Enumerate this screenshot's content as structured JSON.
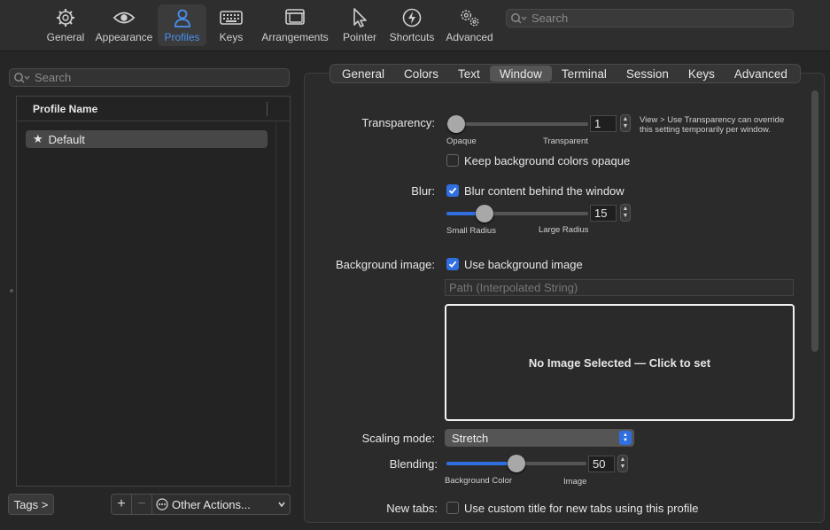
{
  "toolbar": {
    "items": [
      {
        "label": "General",
        "icon": "gear-icon"
      },
      {
        "label": "Appearance",
        "icon": "eye-icon"
      },
      {
        "label": "Profiles",
        "icon": "person-icon",
        "active": true
      },
      {
        "label": "Keys",
        "icon": "keyboard-icon"
      },
      {
        "label": "Arrangements",
        "icon": "windows-icon"
      },
      {
        "label": "Pointer",
        "icon": "pointer-icon"
      },
      {
        "label": "Shortcuts",
        "icon": "lightning-icon"
      },
      {
        "label": "Advanced",
        "icon": "gears-icon"
      }
    ],
    "search_placeholder": "Search"
  },
  "left": {
    "search_placeholder": "Search",
    "column_header": "Profile Name",
    "profiles": [
      {
        "name": "Default",
        "icon": "star-icon"
      }
    ],
    "tags_button": "Tags >",
    "add_button": "+",
    "remove_button": "−",
    "other_actions": "Other Actions..."
  },
  "tabs": [
    "General",
    "Colors",
    "Text",
    "Window",
    "Terminal",
    "Session",
    "Keys",
    "Advanced"
  ],
  "active_tab": "Window",
  "window": {
    "transparency": {
      "label": "Transparency:",
      "value": "1",
      "min_label": "Opaque",
      "max_label": "Transparent",
      "note": "View > Use Transparency can override this setting temporarily per window.",
      "level": 0.01
    },
    "keep_bg_opaque": {
      "label": "Keep background colors opaque",
      "checked": false
    },
    "blur": {
      "label": "Blur:",
      "checkbox_label": "Blur content behind the window",
      "checked": true,
      "value": "15",
      "min_label": "Small Radius",
      "max_label": "Large Radius"
    },
    "background_image": {
      "label": "Background image:",
      "checkbox_label": "Use background image",
      "checked": true,
      "path_placeholder": "Path (Interpolated String)",
      "well_text": "No Image Selected — Click to set"
    },
    "scaling_mode": {
      "label": "Scaling mode:",
      "value": "Stretch"
    },
    "blending": {
      "label": "Blending:",
      "value": "50",
      "min_label": "Background Color",
      "max_label": "Image"
    },
    "new_tabs": {
      "label": "New tabs:",
      "checkbox_label": "Use custom title for new tabs using this profile",
      "checked": false
    }
  },
  "colors": {
    "accent": "#2f6fe0",
    "active_toolbar": "#4a90f0"
  }
}
